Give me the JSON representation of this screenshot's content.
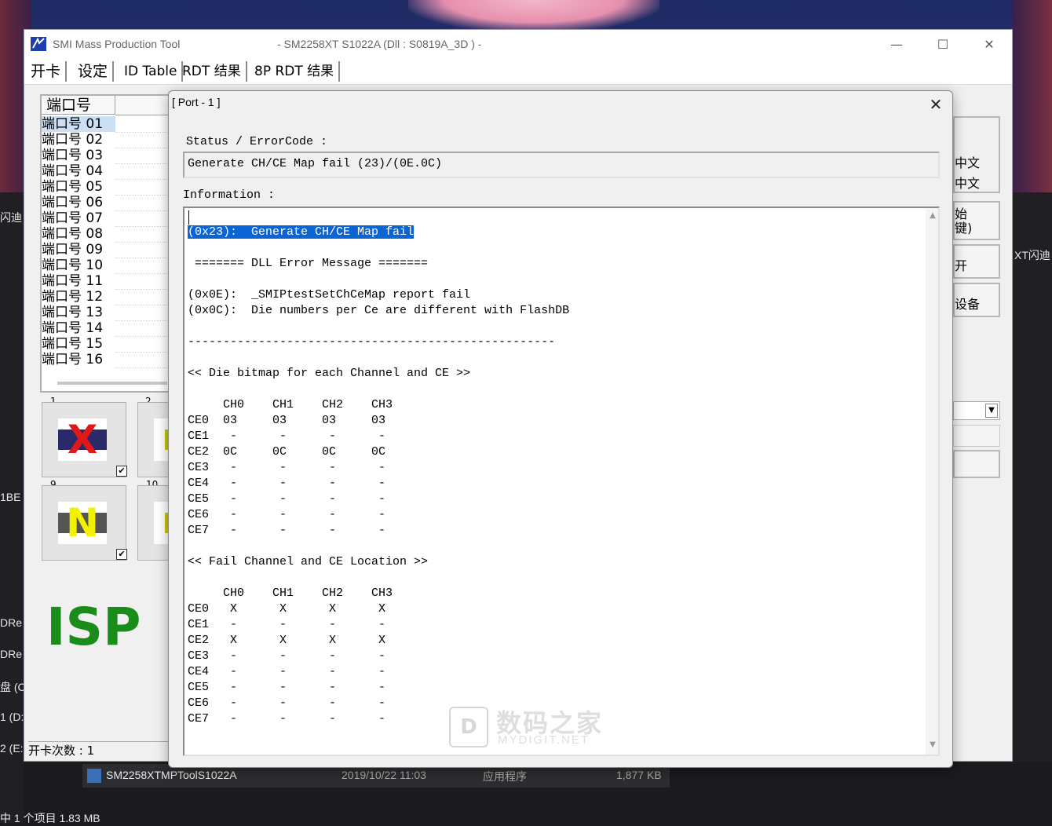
{
  "window": {
    "title": "SMI Mass Production Tool",
    "subtitle": "- SM2258XT   S1022A     (Dll : S0819A_3D ) -",
    "minimize": "—",
    "maximize": "☐",
    "close": "✕"
  },
  "tabs": [
    "开卡",
    "设定",
    "ID Table",
    "RDT 结果",
    "8P RDT 结果"
  ],
  "port_list": {
    "header": "端口号",
    "rows": [
      "端口号  01",
      "端口号  02",
      "端口号  03",
      "端口号  04",
      "端口号  05",
      "端口号  06",
      "端口号  07",
      "端口号  08",
      "端口号  09",
      "端口号  10",
      "端口号  11",
      "端口号  12",
      "端口号  13",
      "端口号  14",
      "端口号  15",
      "端口号  16"
    ]
  },
  "tiles": [
    {
      "num": "1",
      "glyph": "X",
      "glyph_color": "#e01818",
      "checked": "✔"
    },
    {
      "num": "2",
      "glyph": "",
      "glyph_color": "#d8d800",
      "checked": ""
    },
    {
      "num": "9",
      "glyph": "N",
      "glyph_color": "#f2f200",
      "checked": "✔"
    },
    {
      "num": "10",
      "glyph": "",
      "glyph_color": "#d8d800",
      "checked": ""
    }
  ],
  "isp_label": "ISP",
  "status_bar": "开卡次数 : 1",
  "right_panel": {
    "labels": [
      "中文",
      "中文",
      "始\n键)",
      "开",
      "设备"
    ]
  },
  "dialog": {
    "title": "[ Port - 1 ]",
    "close": "✕",
    "status_label": "Status / ErrorCode :",
    "status_value": "Generate CH/CE Map fail (23)/(0E.0C)",
    "info_label": "Information :",
    "info_lines": [
      "(0x23):  Generate CH/CE Map fail",
      "",
      " ======= DLL Error Message =======",
      "",
      "(0x0E):  _SMIPtestSetChCeMap report fail",
      "(0x0C):  Die numbers per Ce are different with FlashDB",
      "",
      "----------------------------------------------------",
      "",
      "<< Die bitmap for each Channel and CE >>",
      "",
      "     CH0    CH1    CH2    CH3",
      "CE0  03     03     03     03",
      "CE1   -      -      -      -",
      "CE2  0C     0C     0C     0C",
      "CE3   -      -      -      -",
      "CE4   -      -      -      -",
      "CE5   -      -      -      -",
      "CE6   -      -      -      -",
      "CE7   -      -      -      -",
      "",
      "<< Fail Channel and CE Location >>",
      "",
      "     CH0    CH1    CH2    CH3",
      "CE0   X      X      X      X",
      "CE1   -      -      -      -",
      "CE2   X      X      X      X",
      "CE3   -      -      -      -",
      "CE4   -      -      -      -",
      "CE5   -      -      -      -",
      "CE6   -      -      -      -",
      "CE7   -      -      -      -"
    ],
    "highlighted_line_index": 0
  },
  "explorer": {
    "file_name": "SM2258XTMPToolS1022A",
    "file_date": "2019/10/22 11:03",
    "file_type": "应用程序",
    "file_size": "1,877 KB",
    "selection_status": "中 1 个项目  1.83 MB",
    "left_fragments": [
      "闪迪",
      "1BE",
      "DRe",
      "DRe",
      "盘 (C",
      "1 (D:",
      "2 (E:"
    ],
    "right_fragments": [
      "XT闪迪"
    ]
  },
  "watermark": {
    "box": "D",
    "cn": "数码之家",
    "en": "MYDIGIT.NET"
  },
  "colors": {
    "highlight": "#0a64d4",
    "isp_green": "#1a8c1a"
  }
}
